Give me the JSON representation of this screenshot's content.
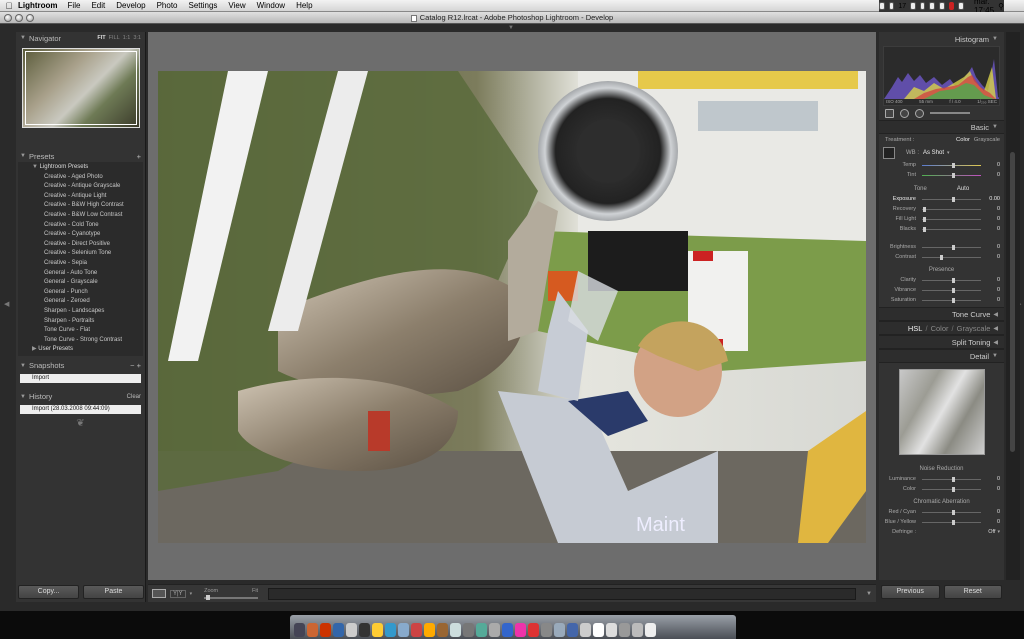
{
  "menubar": {
    "app_name": "Lightroom",
    "items": [
      "File",
      "Edit",
      "Develop",
      "Photo",
      "Settings",
      "View",
      "Window",
      "Help"
    ],
    "clock": "mar. 17:45",
    "date_badge": "17"
  },
  "window": {
    "title": "Catalog R12.lrcat - Adobe Photoshop Lightroom - Develop"
  },
  "navigator": {
    "title": "Navigator",
    "options": [
      "FIT",
      "FILL",
      "1:1",
      "3:1"
    ]
  },
  "presets": {
    "title": "Presets",
    "add_label": "+",
    "group_lightroom": "Lightroom Presets",
    "items": [
      "Creative - Aged Photo",
      "Creative - Antique Grayscale",
      "Creative - Antique Light",
      "Creative - B&W High Contrast",
      "Creative - B&W Low Contrast",
      "Creative - Cold Tone",
      "Creative - Cyanotype",
      "Creative - Direct Positive",
      "Creative - Selenium Tone",
      "Creative - Sepia",
      "General - Auto Tone",
      "General - Grayscale",
      "General - Punch",
      "General - Zeroed",
      "Sharpen - Landscapes",
      "Sharpen - Portraits",
      "Tone Curve - Flat",
      "Tone Curve - Strong Contrast"
    ],
    "group_user": "User Presets"
  },
  "snapshots": {
    "title": "Snapshots",
    "minus": "−",
    "plus": "+",
    "items": [
      "Import"
    ]
  },
  "history": {
    "title": "History",
    "clear_label": "Clear",
    "items": [
      "Import (28.03.2008 09:44:09)"
    ]
  },
  "left_buttons": {
    "copy": "Copy...",
    "paste": "Paste"
  },
  "toolbar": {
    "zoom_label": "Zoom",
    "fit_label": "Fit",
    "compare_label": "Y|Y"
  },
  "histogram": {
    "title": "Histogram",
    "iso": "ISO 400",
    "focal": "55 mm",
    "aperture": "f / 4.0",
    "shutter": "1/₂₀₀ SEC"
  },
  "basic": {
    "title": "Basic",
    "treatment_label": "Treatment :",
    "color_label": "Color",
    "grayscale_label": "Grayscale",
    "wb_label": "WB :",
    "wb_value": "As Shot",
    "temp_label": "Temp",
    "temp_value": "0",
    "tint_label": "Tint",
    "tint_value": "0",
    "tone_label": "Tone",
    "auto_label": "Auto",
    "tone_sliders": [
      {
        "label": "Exposure",
        "value": "0.00",
        "pos": 50
      },
      {
        "label": "Recovery",
        "value": "0",
        "pos": 2
      },
      {
        "label": "Fill Light",
        "value": "0",
        "pos": 2
      },
      {
        "label": "Blacks",
        "value": "0",
        "pos": 2
      }
    ],
    "bc_sliders": [
      {
        "label": "Brightness",
        "value": "0",
        "pos": 50
      },
      {
        "label": "Contrast",
        "value": "0",
        "pos": 30
      }
    ],
    "presence_label": "Presence",
    "presence_sliders": [
      {
        "label": "Clarity",
        "value": "0",
        "pos": 50
      },
      {
        "label": "Vibrance",
        "value": "0",
        "pos": 50
      },
      {
        "label": "Saturation",
        "value": "0",
        "pos": 50
      }
    ]
  },
  "tone_curve": {
    "title": "Tone Curve"
  },
  "hsl": {
    "hsl": "HSL",
    "color": "Color",
    "grayscale": "Grayscale",
    "sep": "/"
  },
  "split_toning": {
    "title": "Split Toning"
  },
  "detail": {
    "title": "Detail",
    "noise_label": "Noise Reduction",
    "noise_sliders": [
      {
        "label": "Luminance",
        "value": "0",
        "pos": 50
      },
      {
        "label": "Color",
        "value": "0",
        "pos": 50
      }
    ],
    "chroma_label": "Chromatic Aberration",
    "chroma_sliders": [
      {
        "label": "Red / Cyan",
        "value": "0",
        "pos": 50
      },
      {
        "label": "Blue / Yellow",
        "value": "0",
        "pos": 50
      }
    ],
    "defringe_label": "Defringe :",
    "defringe_value": "Off"
  },
  "right_buttons": {
    "previous": "Previous",
    "reset": "Reset"
  },
  "photo": {
    "jacket_text": "Maint"
  }
}
